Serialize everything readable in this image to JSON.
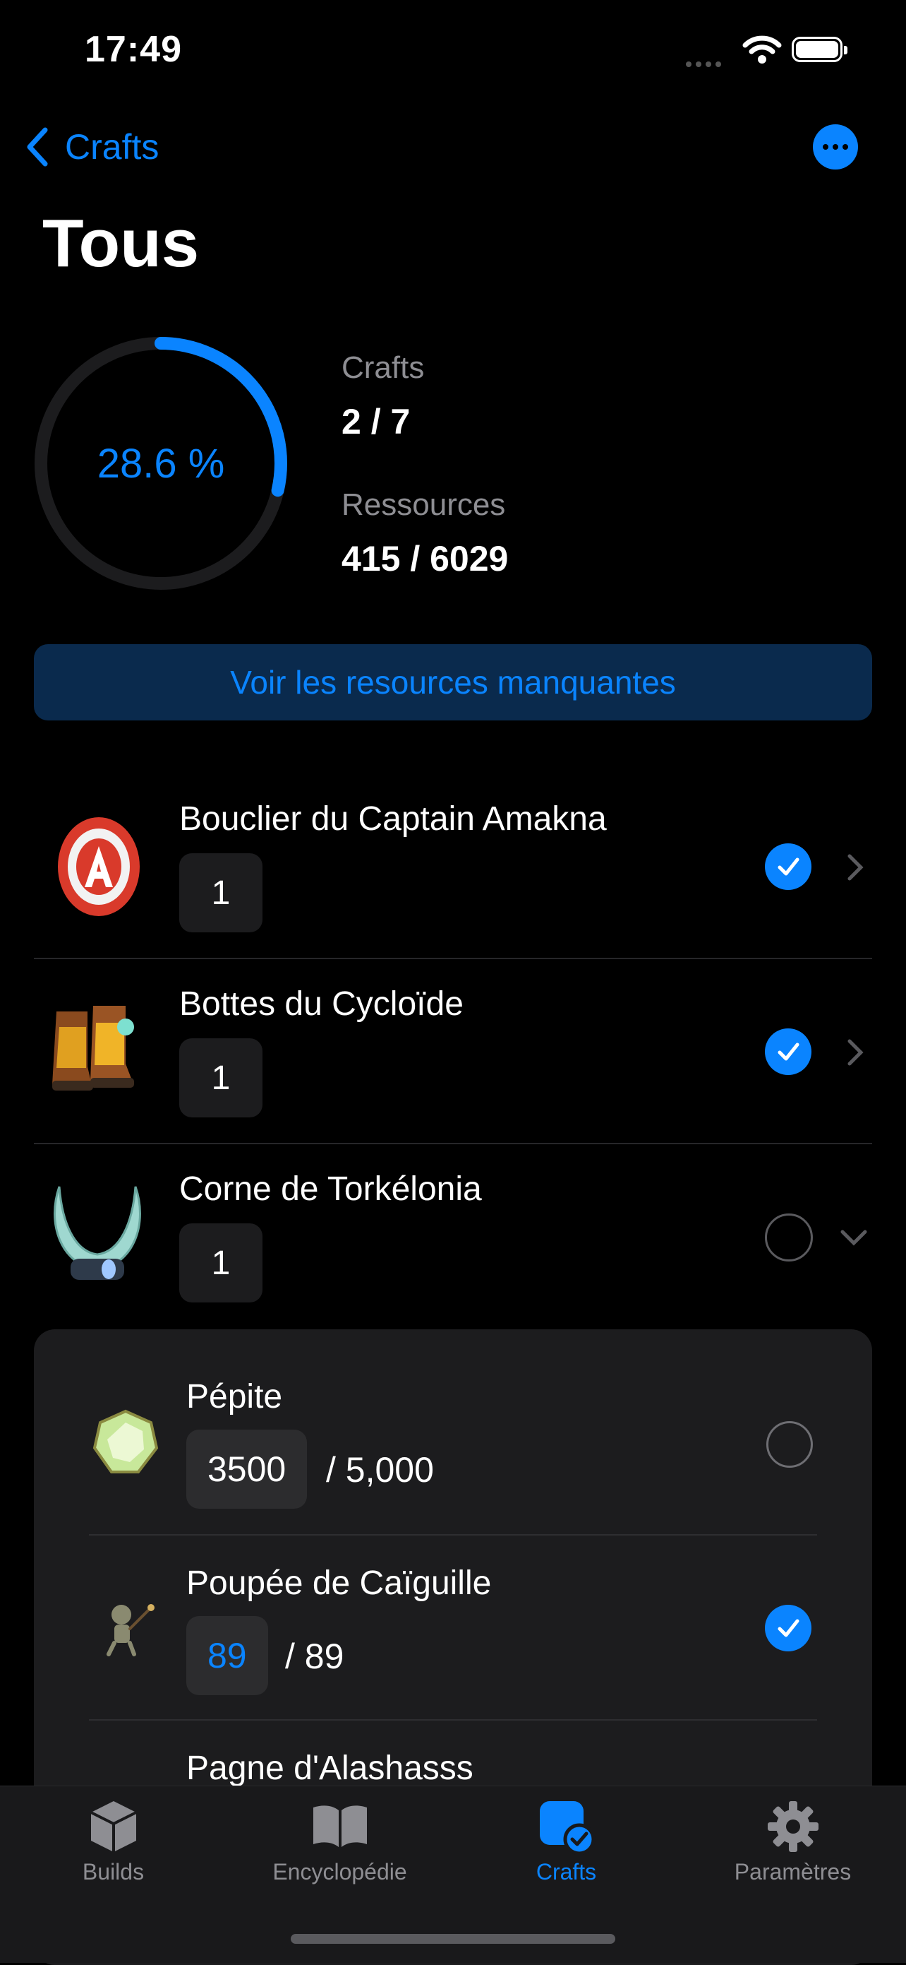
{
  "status": {
    "time": "17:49"
  },
  "nav": {
    "back_label": "Crafts",
    "more_icon": "ellipsis-circle-icon"
  },
  "page": {
    "title": "Tous"
  },
  "progress": {
    "fraction": 0.286,
    "percent_text": "28.6 %",
    "crafts_label": "Crafts",
    "crafts_value": "2 / 7",
    "resources_label": "Ressources",
    "resources_value": "415 / 6029",
    "accent": "#0a84ff"
  },
  "missing_button": {
    "label": "Voir les resources manquantes"
  },
  "crafts": [
    {
      "name": "Bouclier du Captain Amakna",
      "quantity": "1",
      "done": true
    },
    {
      "name": "Bottes du Cycloïde",
      "quantity": "1",
      "done": true
    },
    {
      "name": "Corne de Torkélonia",
      "quantity": "1",
      "done": false
    }
  ],
  "resources": [
    {
      "name": "Pépite",
      "owned": "3500",
      "total": "/ 5,000",
      "done": false
    },
    {
      "name": "Poupée de Caïguille",
      "owned": "89",
      "total": "/ 89",
      "done": true
    },
    {
      "name": "Pagne d'Alashasss"
    }
  ],
  "tabs": [
    {
      "label": "Builds",
      "icon": "cube-icon"
    },
    {
      "label": "Encyclopédie",
      "icon": "book-icon"
    },
    {
      "label": "Crafts",
      "icon": "crafts-check-icon",
      "active": true
    },
    {
      "label": "Paramètres",
      "icon": "gear-icon"
    }
  ]
}
